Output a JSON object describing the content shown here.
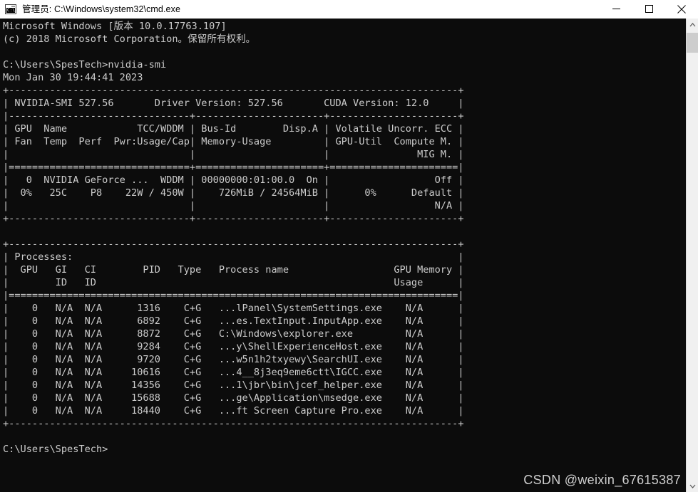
{
  "window": {
    "title": "管理员: C:\\Windows\\system32\\cmd.exe",
    "icon": "cmd-console-icon",
    "background_color": "#0c0c0c",
    "foreground_color": "#cccccc",
    "titlebar_color": "#ffffff",
    "controls": {
      "minimize_label": "—",
      "maximize_label": "□",
      "close_label": "✕"
    }
  },
  "scrollbar": {
    "up_arrow": "∧",
    "down_arrow": "∨",
    "thumb_name": "scrollbar-thumb"
  },
  "watermark": {
    "text": "CSDN @weixin_67615387"
  },
  "console": {
    "banner": [
      "Microsoft Windows [版本 10.0.17763.107]",
      "(c) 2018 Microsoft Corporation。保留所有权利。"
    ],
    "prompt_line": "C:\\Users\\SpesTech>nvidia-smi",
    "timestamp": "Mon Jan 30 19:44:41 2023",
    "final_prompt": "C:\\Users\\SpesTech>",
    "text": "Microsoft Windows [版本 10.0.17763.107]\n(c) 2018 Microsoft Corporation。保留所有权利。\n\nC:\\Users\\SpesTech>nvidia-smi\nMon Jan 30 19:44:41 2023\n+-----------------------------------------------------------------------------+\n| NVIDIA-SMI 527.56       Driver Version: 527.56       CUDA Version: 12.0     |\n|-------------------------------+----------------------+----------------------+\n| GPU  Name            TCC/WDDM | Bus-Id        Disp.A | Volatile Uncorr. ECC |\n| Fan  Temp  Perf  Pwr:Usage/Cap| Memory-Usage         | GPU-Util  Compute M. |\n|                               |                      |               MIG M. |\n|===============================+======================+======================|\n|   0  NVIDIA GeForce ...  WDDM | 00000000:01:00.0  On |                  Off |\n|  0%   25C    P8    22W / 450W |    726MiB / 24564MiB |      0%      Default |\n|                               |                      |                  N/A |\n+-------------------------------+----------------------+----------------------+\n\n+-----------------------------------------------------------------------------+\n| Processes:                                                                  |\n|  GPU   GI   CI        PID   Type   Process name                  GPU Memory |\n|        ID   ID                                                   Usage      |\n|=============================================================================|\n|    0   N/A  N/A      1316    C+G   ...lPanel\\SystemSettings.exe    N/A      |\n|    0   N/A  N/A      6892    C+G   ...es.TextInput.InputApp.exe    N/A      |\n|    0   N/A  N/A      8872    C+G   C:\\Windows\\explorer.exe         N/A      |\n|    0   N/A  N/A      9284    C+G   ...y\\ShellExperienceHost.exe    N/A      |\n|    0   N/A  N/A      9720    C+G   ...w5n1h2txyewy\\SearchUI.exe    N/A      |\n|    0   N/A  N/A     10616    C+G   ...4__8j3eq9eme6ctt\\IGCC.exe    N/A      |\n|    0   N/A  N/A     14356    C+G   ...1\\jbr\\bin\\jcef_helper.exe    N/A      |\n|    0   N/A  N/A     15688    C+G   ...ge\\Application\\msedge.exe    N/A      |\n|    0   N/A  N/A     18440    C+G   ...ft Screen Capture Pro.exe    N/A      |\n+-----------------------------------------------------------------------------+\n\nC:\\Users\\SpesTech>"
  },
  "nvidia_smi": {
    "version": "527.56",
    "driver_version": "527.56",
    "cuda_version": "12.0",
    "header_columns": [
      "GPU",
      "Name",
      "TCC/WDDM",
      "Bus-Id",
      "Disp.A",
      "Volatile Uncorr. ECC",
      "Fan",
      "Temp",
      "Perf",
      "Pwr:Usage/Cap",
      "Memory-Usage",
      "GPU-Util",
      "Compute M.",
      "MIG M."
    ],
    "gpus": [
      {
        "index": "0",
        "name": "NVIDIA GeForce ...",
        "tcc_wddm": "WDDM",
        "bus_id": "00000000:01:00.0",
        "disp_a": "On",
        "ecc": "Off",
        "fan": "0%",
        "temp": "25C",
        "perf": "P8",
        "power": "22W / 450W",
        "memory": "726MiB / 24564MiB",
        "gpu_util": "0%",
        "compute_mode": "Default",
        "mig_mode": "N/A"
      }
    ],
    "processes_title": "Processes:",
    "process_columns": [
      "GPU",
      "GI ID",
      "CI ID",
      "PID",
      "Type",
      "Process name",
      "GPU Memory Usage"
    ],
    "processes": [
      {
        "gpu": "0",
        "gi_id": "N/A",
        "ci_id": "N/A",
        "pid": "1316",
        "type": "C+G",
        "name": "...lPanel\\SystemSettings.exe",
        "memory": "N/A"
      },
      {
        "gpu": "0",
        "gi_id": "N/A",
        "ci_id": "N/A",
        "pid": "6892",
        "type": "C+G",
        "name": "...es.TextInput.InputApp.exe",
        "memory": "N/A"
      },
      {
        "gpu": "0",
        "gi_id": "N/A",
        "ci_id": "N/A",
        "pid": "8872",
        "type": "C+G",
        "name": "C:\\Windows\\explorer.exe",
        "memory": "N/A"
      },
      {
        "gpu": "0",
        "gi_id": "N/A",
        "ci_id": "N/A",
        "pid": "9284",
        "type": "C+G",
        "name": "...y\\ShellExperienceHost.exe",
        "memory": "N/A"
      },
      {
        "gpu": "0",
        "gi_id": "N/A",
        "ci_id": "N/A",
        "pid": "9720",
        "type": "C+G",
        "name": "...w5n1h2txyewy\\SearchUI.exe",
        "memory": "N/A"
      },
      {
        "gpu": "0",
        "gi_id": "N/A",
        "ci_id": "N/A",
        "pid": "10616",
        "type": "C+G",
        "name": "...4__8j3eq9eme6ctt\\IGCC.exe",
        "memory": "N/A"
      },
      {
        "gpu": "0",
        "gi_id": "N/A",
        "ci_id": "N/A",
        "pid": "14356",
        "type": "C+G",
        "name": "...1\\jbr\\bin\\jcef_helper.exe",
        "memory": "N/A"
      },
      {
        "gpu": "0",
        "gi_id": "N/A",
        "ci_id": "N/A",
        "pid": "15688",
        "type": "C+G",
        "name": "...ge\\Application\\msedge.exe",
        "memory": "N/A"
      },
      {
        "gpu": "0",
        "gi_id": "N/A",
        "ci_id": "N/A",
        "pid": "18440",
        "type": "C+G",
        "name": "...ft Screen Capture Pro.exe",
        "memory": "N/A"
      }
    ]
  }
}
